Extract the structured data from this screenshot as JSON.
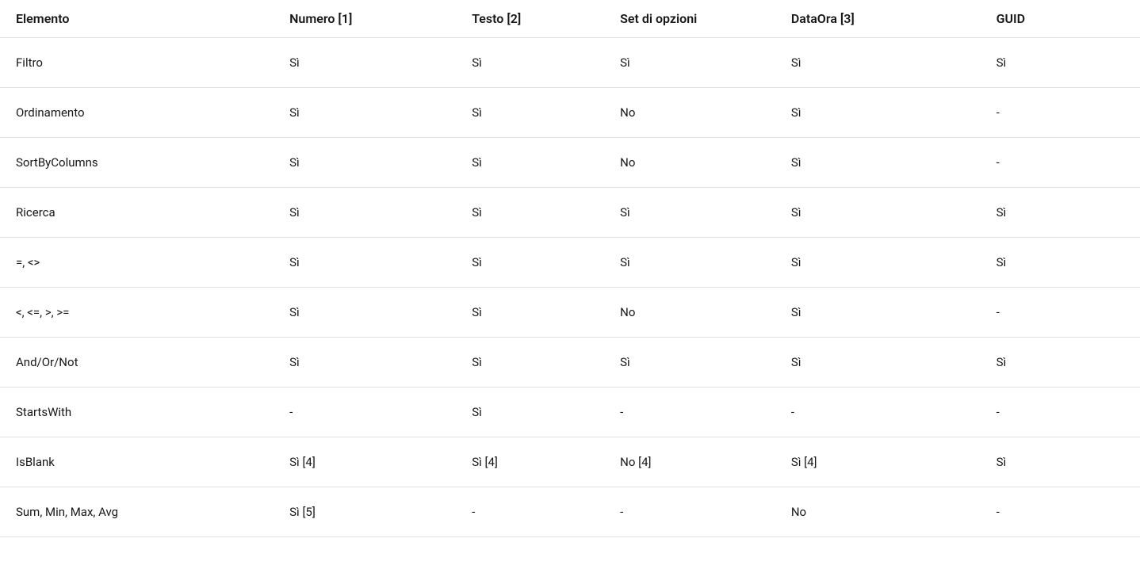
{
  "table": {
    "headers": [
      "Elemento",
      "Numero [1]",
      "Testo [2]",
      "Set di opzioni",
      "DataOra [3]",
      "GUID"
    ],
    "rows": [
      {
        "cells": [
          "Filtro",
          "Sì",
          "Sì",
          "Sì",
          "Sì",
          "Sì"
        ]
      },
      {
        "cells": [
          "Ordinamento",
          "Sì",
          "Sì",
          "No",
          "Sì",
          "-"
        ]
      },
      {
        "cells": [
          "SortByColumns",
          "Sì",
          "Sì",
          "No",
          "Sì",
          "-"
        ]
      },
      {
        "cells": [
          "Ricerca",
          "Sì",
          "Sì",
          "Sì",
          "Sì",
          "Sì"
        ]
      },
      {
        "cells": [
          "=, <>",
          "Sì",
          "Sì",
          "Sì",
          "Sì",
          "Sì"
        ]
      },
      {
        "cells": [
          "<, <=, >, >=",
          "Sì",
          "Sì",
          "No",
          "Sì",
          "-"
        ]
      },
      {
        "cells": [
          "And/Or/Not",
          "Sì",
          "Sì",
          "Sì",
          "Sì",
          "Sì"
        ]
      },
      {
        "cells": [
          "StartsWith",
          "-",
          "Sì",
          "-",
          "-",
          "-"
        ]
      },
      {
        "cells": [
          "IsBlank",
          "Sì [4]",
          "Sì [4]",
          "No [4]",
          "Sì [4]",
          "Sì"
        ]
      },
      {
        "cells": [
          "Sum, Min, Max, Avg",
          "Sì [5]",
          "-",
          "-",
          "No",
          "-"
        ]
      }
    ]
  }
}
